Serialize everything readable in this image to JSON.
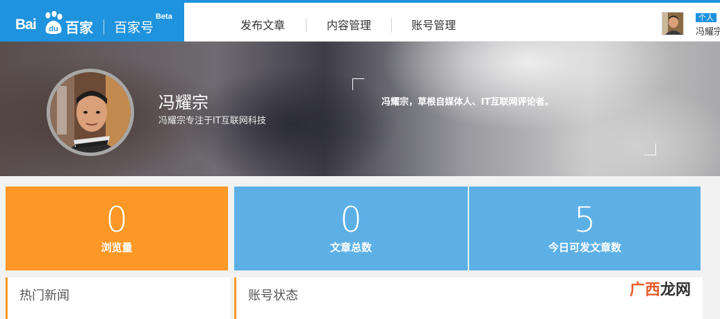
{
  "brand": {
    "logo_latin_a": "Bai",
    "logo_latin_b": "du",
    "logo_cn": "百家",
    "product": "百家号",
    "beta": "Beta"
  },
  "nav": {
    "items": [
      {
        "label": "发布文章"
      },
      {
        "label": "内容管理"
      },
      {
        "label": "账号管理"
      }
    ]
  },
  "user": {
    "badge": "个人",
    "name_short": "冯耀宗"
  },
  "banner": {
    "name": "冯耀宗",
    "description": "冯耀宗专注于IT互联网科技",
    "intro": "冯耀宗，草根自媒体人、IT互联网评论者。"
  },
  "stats": [
    {
      "value": "0",
      "label": "浏览量"
    },
    {
      "value": "0",
      "label": "文章总数"
    },
    {
      "value": "5",
      "label": "今日可发文章数"
    }
  ],
  "panels": {
    "hot_news": "热门新闻",
    "account_status": "账号状态"
  },
  "watermark": {
    "part_a": "广西",
    "part_b": "龙网"
  },
  "colors": {
    "brand_blue": "#1f93dd",
    "stat_orange": "#fd9726",
    "stat_blue": "#5cb0e6"
  }
}
